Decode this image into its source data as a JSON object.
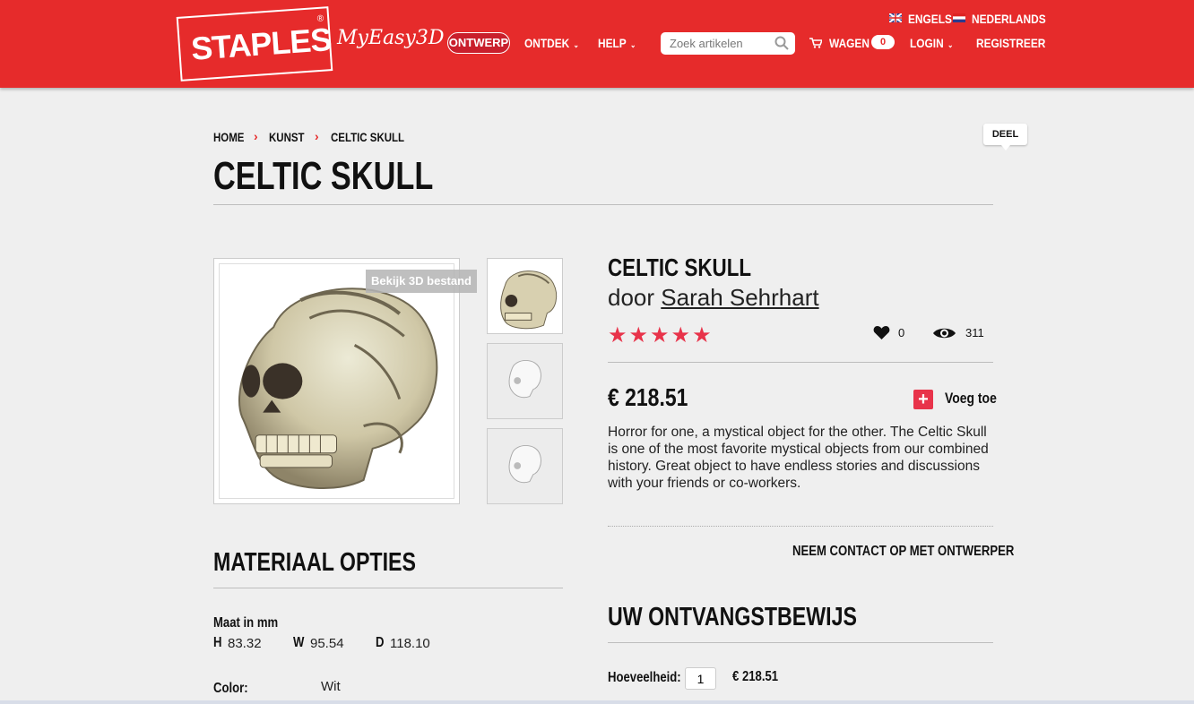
{
  "header": {
    "logo_text": "STAPLES",
    "logo_reg": "®",
    "sublogo": "MyEasy3D",
    "nav": {
      "design": "ONTWERP",
      "discover": "ONTDEK",
      "help": "HELP",
      "cart": "WAGEN",
      "cart_count": "0",
      "login": "LOGIN",
      "register": "REGISTREER"
    },
    "lang": {
      "english": "ENGELS",
      "dutch": "NEDERLANDS"
    },
    "search": {
      "placeholder": "Zoek artikelen"
    }
  },
  "breadcrumb": [
    "HOME",
    "KUNST",
    "CELTIC SKULL"
  ],
  "page_title": "CELTIC SKULL",
  "share_label": "DEEL",
  "view3d_label": "Bekijk 3D bestand",
  "product": {
    "name": "CELTIC SKULL",
    "by_prefix": "door",
    "designer": "Sarah Sehrhart",
    "stars": "★★★★★",
    "likes": "0",
    "views": "311",
    "price": "€ 218.51",
    "add_label": "Voeg toe",
    "description": "Horror for one, a mystical object for the other. The Celtic Skull is one of the most favorite mystical objects from our combined history. Great object to have endless stories and discussions with your friends or co-workers.",
    "contact": "NEEM CONTACT OP MET ONTWERPER"
  },
  "material": {
    "title": "MATERIAAL OPTIES",
    "size_label": "Maat in mm",
    "h_label": "H",
    "h_value": "83.32",
    "w_label": "W",
    "w_value": "95.54",
    "d_label": "D",
    "d_value": "118.10",
    "color_label": "Color:",
    "color_value": "Wit"
  },
  "receipt": {
    "title": "UW ONTVANGSTBEWIJS",
    "qty_label": "Hoeveelheid:",
    "qty_value": "1",
    "total": "€ 218.51"
  },
  "colors": {
    "brand_red": "#e62b2b",
    "star_red": "#e8334a"
  }
}
